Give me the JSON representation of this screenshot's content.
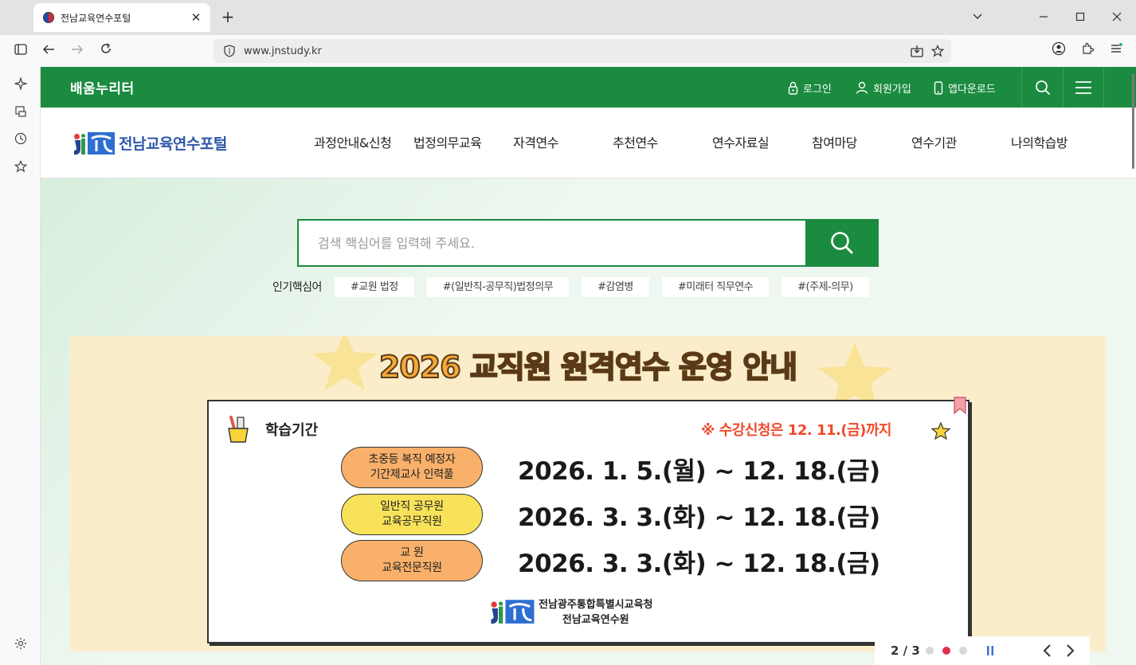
{
  "browser": {
    "tab_title": "전남교육연수포털",
    "tab_close": "✕",
    "new_tab": "+",
    "url": "www.jnstudy.kr"
  },
  "site": {
    "brand": "배움누리터",
    "util_links": {
      "login": "로그인",
      "join": "회원가입",
      "app": "앱다운로드"
    },
    "logo_text": "전남교육연수포털",
    "nav": [
      "과정안내&신청",
      "법정의무교육",
      "자격연수",
      "추천연수",
      "연수자료실",
      "참여마당",
      "연수기관",
      "나의학습방"
    ]
  },
  "search": {
    "placeholder": "검색 핵심어를 입력해 주세요.",
    "popular_label": "인기핵심어",
    "tags": [
      "#교원 법정",
      "#(일반직-공무직)법정의무",
      "#감염병",
      "#미래터 직무연수",
      "#(주제-의무)"
    ]
  },
  "banner": {
    "title_part1": "2026 교직원 ",
    "title_part2": "원격연수 운영 안내",
    "period_label": "학습기간",
    "notice": "※ 수강신청은 12. 11.(금)까지",
    "rows": [
      {
        "line1": "초중등 복직 예정자",
        "line2": "기간제교사 인력풀",
        "date": "2026. 1. 5.(월) ~ 12. 18.(금)",
        "color": "#f8b06a"
      },
      {
        "line1": "일반직 공무원",
        "line2": "교육공무직원",
        "date": "2026. 3. 3.(화) ~ 12. 18.(금)",
        "color": "#f8e25a"
      },
      {
        "line1": "교  원",
        "line2": "교육전문직원",
        "date": "2026. 3. 3.(화) ~ 12. 18.(금)",
        "color": "#f8b06a"
      }
    ],
    "org_line1": "전남광주통합특별시교육청",
    "org_line2": "전남교육연수원"
  },
  "pager": {
    "count": "2 / 3",
    "active_index": 1
  },
  "colors": {
    "brand_green": "#1b8b3f",
    "banner_bg": "#fbedc9",
    "notice_red": "#ef4b2b"
  }
}
